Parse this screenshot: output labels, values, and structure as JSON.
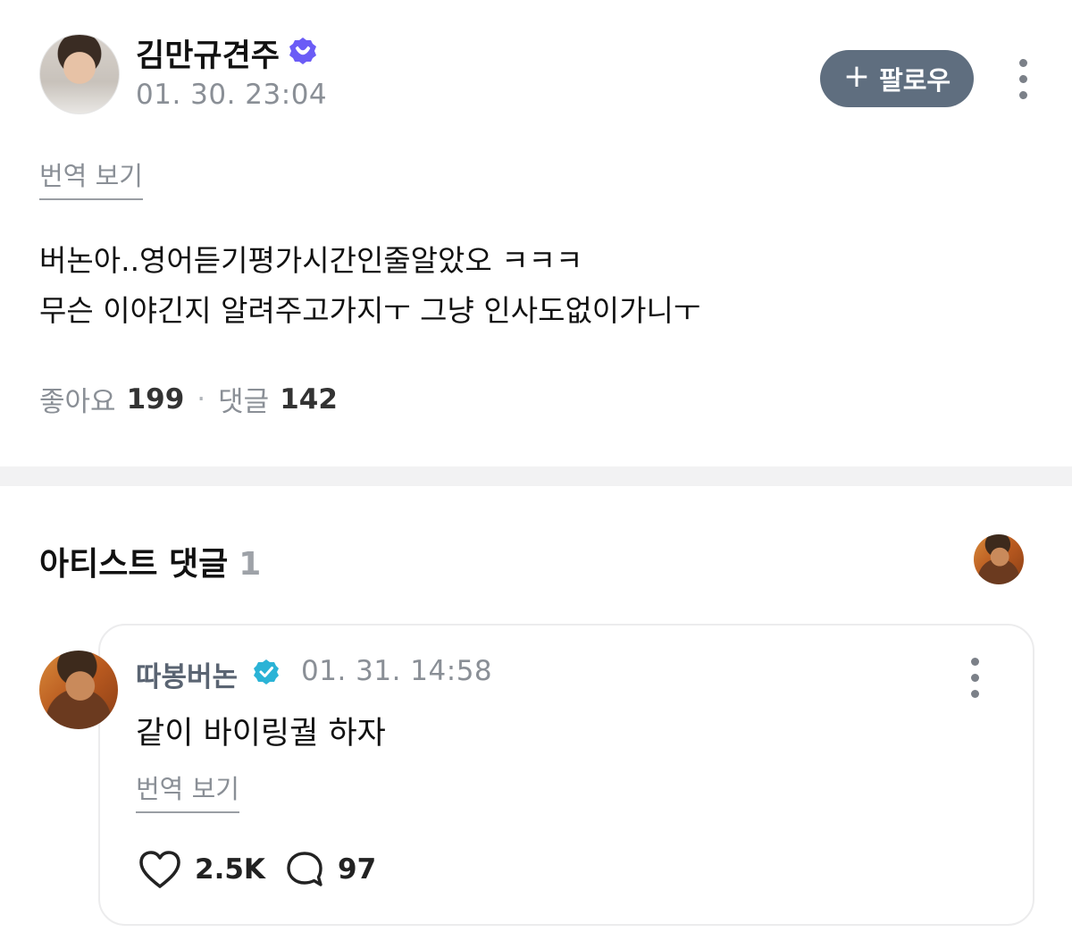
{
  "post": {
    "author": "김만규견주",
    "time": "01. 30. 23:04",
    "follow_label": "팔로우",
    "translate_label": "번역 보기",
    "body_lines": [
      "버논아..영어듣기평가시간인줄알았오 ㅋㅋㅋ",
      "무슨 이야긴지 알려주고가지ㅜ 그냥 인사도없이가니ㅜ"
    ],
    "likes_label": "좋아요",
    "likes_count": "199",
    "comments_label": "댓글",
    "comments_count": "142"
  },
  "artist_comments": {
    "title": "아티스트 댓글",
    "count": "1"
  },
  "comment": {
    "author": "따봉버논",
    "time": "01. 31. 14:58",
    "text": "같이 바이링궐 하자",
    "translate_label": "번역 보기",
    "likes": "2.5K",
    "replies": "97"
  },
  "colors": {
    "follow_button": "#5f6e7f",
    "post_badge": "#6b5cf6",
    "comment_badge": "#2bb3d6"
  }
}
